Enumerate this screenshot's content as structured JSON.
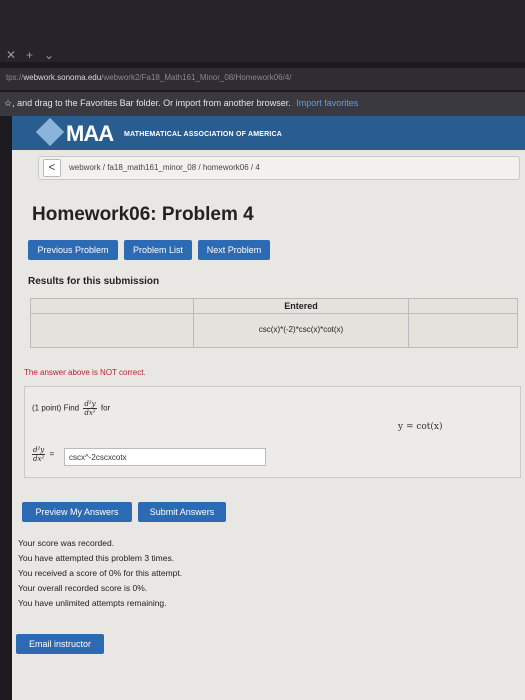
{
  "browser": {
    "tab_close": "✕",
    "tab_new": "+",
    "tab_menu": "⌄",
    "url_prefix": "tps://",
    "url_domain": "webwork.sonoma.edu",
    "url_path": "/webwork2/Fa18_Math161_Minor_08/Homework06/4/",
    "favorites_hint": "☆, and drag to the Favorites Bar folder. Or import from another browser.",
    "favorites_link": "Import favorites"
  },
  "masthead": {
    "logo_text": "MAA",
    "org_name": "MATHEMATICAL ASSOCIATION OF AMERICA"
  },
  "breadcrumb": {
    "back": "<",
    "path": "webwork / fa18_math161_minor_08 / homework06 / 4"
  },
  "page_title": "Homework06: Problem 4",
  "nav": {
    "previous": "Previous Problem",
    "list": "Problem List",
    "next": "Next Problem"
  },
  "results": {
    "heading": "Results for this submission",
    "column_header": "Entered",
    "entered_value": "csc(x)*(-2)*csc(x)*cot(x)",
    "feedback": "The answer above is NOT correct."
  },
  "problem": {
    "prefix": "(1 point) Find",
    "suffix": "for",
    "frac_num": "d²y",
    "frac_den": "dx²",
    "given": "y = cot(x)",
    "equals": "=",
    "answer_value": "cscx^-2cscxcotx"
  },
  "actions": {
    "preview": "Preview My Answers",
    "submit": "Submit Answers"
  },
  "score_lines": [
    "Your score was recorded.",
    "You have attempted this problem 3 times.",
    "You received a score of 0% for this attempt.",
    "Your overall recorded score is 0%.",
    "You have unlimited attempts remaining."
  ],
  "email_button": "Email instructor",
  "colors": {
    "masthead": "#2a5d8f",
    "button": "#2c6bb3",
    "error_text": "#bb2233"
  }
}
